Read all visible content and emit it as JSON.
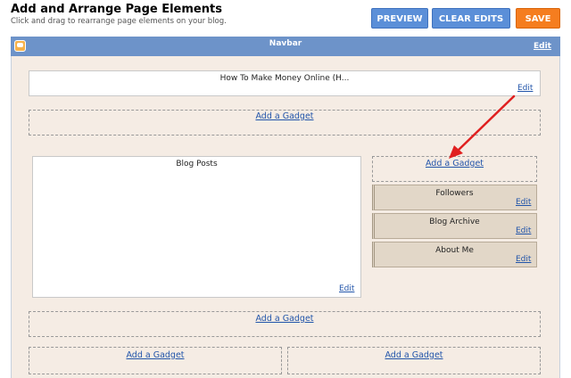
{
  "header": {
    "title": "Add and Arrange Page Elements",
    "subtitle": "Click and drag to rearrange page elements on your blog.",
    "buttons": {
      "preview": "PREVIEW",
      "clear_edits": "CLEAR EDITS",
      "save": "SAVE"
    }
  },
  "colors": {
    "canvas": "#f5ece4",
    "navbar": "#6d93c9",
    "button_blue": "#5b8fd8",
    "button_orange": "#f57d1f",
    "link": "#2255aa",
    "arrow": "#e02020"
  },
  "navbar": {
    "title": "Navbar",
    "edit": "Edit",
    "icon": "blogger-icon"
  },
  "header_widget": {
    "title": "How To Make Money Online (H...",
    "edit": "Edit"
  },
  "add_gadget_label": "Add a Gadget",
  "main": {
    "title": "Blog Posts",
    "edit": "Edit"
  },
  "sidebar": {
    "add_gadget": "Add a Gadget",
    "gadgets": [
      {
        "title": "Followers",
        "edit": "Edit"
      },
      {
        "title": "Blog Archive",
        "edit": "Edit"
      },
      {
        "title": "About Me",
        "edit": "Edit"
      }
    ]
  },
  "footer": {
    "add_gadget": "Add a Gadget",
    "left_add_gadget": "Add a Gadget",
    "right_add_gadget": "Add a Gadget"
  }
}
